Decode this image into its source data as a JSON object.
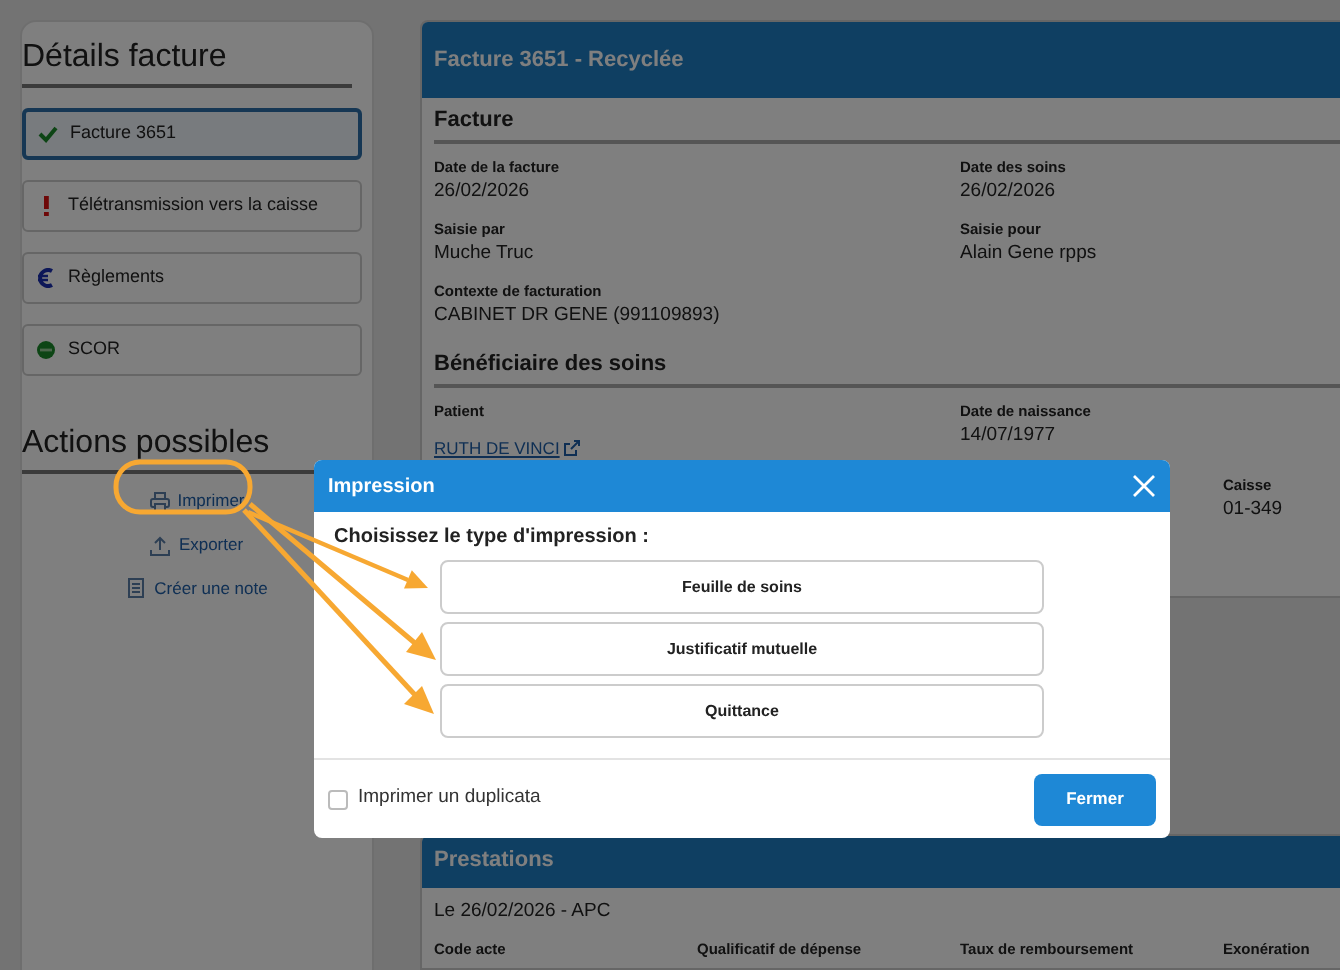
{
  "sidebar": {
    "title": "Détails facture",
    "items": [
      {
        "label": "Facture 3651",
        "kind": "check",
        "selected": true
      },
      {
        "label": "Télétransmission vers la caisse",
        "kind": "alert",
        "selected": false
      },
      {
        "label": "Règlements",
        "kind": "euro",
        "selected": false
      },
      {
        "label": "SCOR",
        "kind": "status",
        "selected": false
      }
    ],
    "actions_title": "Actions possibles",
    "actions": [
      {
        "label": "Imprimer",
        "kind": "printer"
      },
      {
        "label": "Exporter",
        "kind": "upload"
      },
      {
        "label": "Créer une note",
        "kind": "note"
      }
    ]
  },
  "invoice": {
    "title": "Facture 3651 - Recyclée",
    "sections": [
      {
        "title": "Facture",
        "fields": [
          {
            "label": "Date de la facture",
            "value": "26/02/2026",
            "kind": "text"
          },
          {
            "label": "Date des soins",
            "value": "26/02/2026",
            "kind": "text"
          },
          {
            "label": "Saisie par",
            "value": "Muche Truc",
            "kind": "text"
          },
          {
            "label": "Saisie pour",
            "value": "Alain Gene rpps",
            "kind": "text"
          },
          {
            "label": "Contexte de facturation",
            "value": "CABINET DR GENE (991109893)",
            "kind": "text"
          }
        ]
      },
      {
        "title": "Bénéficiaire des soins",
        "fields": [
          {
            "label": "Patient",
            "value": "RUTH DE VINCI",
            "kind": "link"
          },
          {
            "label": "Date de naissance",
            "value": "14/07/1977",
            "kind": "text"
          }
        ]
      }
    ],
    "caisse": {
      "label": "Caisse",
      "value": "01-349"
    }
  },
  "prestations": {
    "title": "Prestations",
    "subtitle": "Le 26/02/2026 - APC",
    "columns": [
      "Code acte",
      "Qualificatif de dépense",
      "Taux de remboursement",
      "Exonération"
    ]
  },
  "dialog": {
    "title": "Impression",
    "prompt": "Choisissez le type d'impression :",
    "options": [
      "Feuille de soins",
      "Justificatif mutuelle",
      "Quittance"
    ],
    "duplicate": {
      "label": "Imprimer un duplicata",
      "checked": false
    },
    "close_button": "Fermer"
  }
}
